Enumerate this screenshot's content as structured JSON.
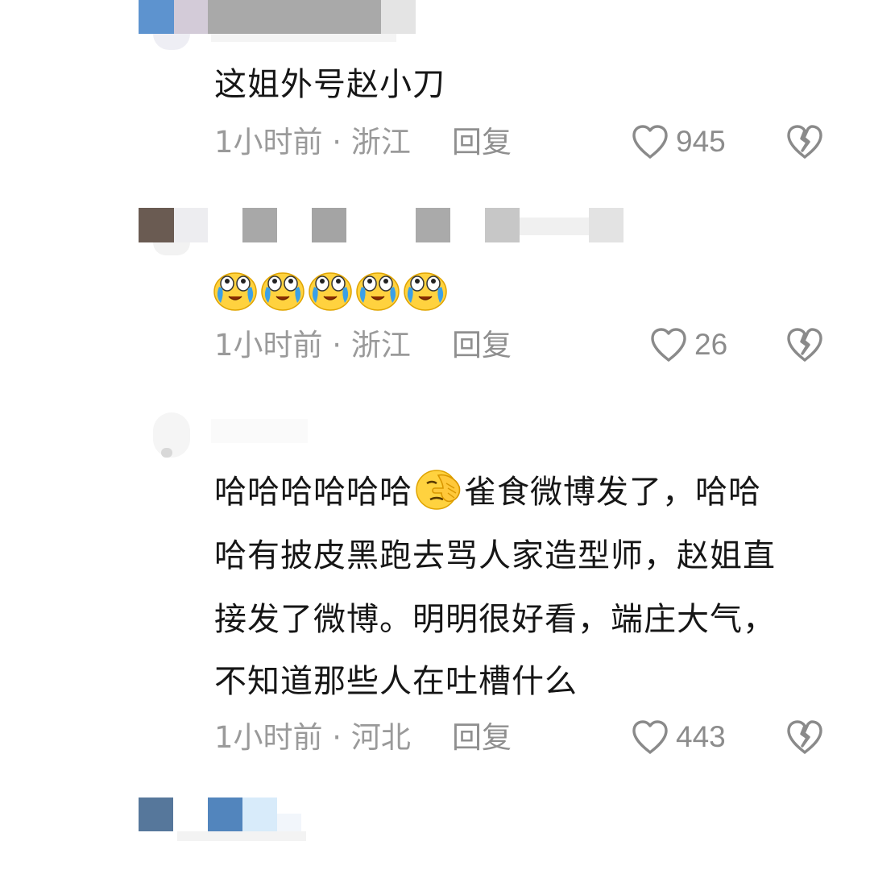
{
  "comments": [
    {
      "text_lines": [
        "这姐外号赵小刀"
      ],
      "time": "1小时前",
      "location": "浙江",
      "reply_label": "回复",
      "like_count": "945"
    },
    {
      "emoji_count": 5,
      "emoji_icon": "crying-laughing-emoji",
      "time": "1小时前",
      "location": "浙江",
      "reply_label": "回复",
      "like_count": "26"
    },
    {
      "text_line_1_before_emoji": "哈哈哈哈哈哈",
      "inline_emoji_icon": "facepalm-emoji",
      "text_line_1_after_emoji": "雀食微博发了，哈哈",
      "text_lines_rest": [
        "哈有披皮黑跑去骂人家造型师，赵姐直",
        "接发了微博。明明很好看，端庄大气，",
        "不知道那些人在吐槽什么"
      ],
      "time": "1小时前",
      "location": "河北",
      "reply_label": "回复",
      "like_count": "443"
    }
  ],
  "meta_separator": " · ",
  "colors": {
    "text": "#161616",
    "meta": "#9a9a9a",
    "icon": "#8a8a8a",
    "emoji_face": "#ffd23f",
    "emoji_tears": "#3aa0e8"
  }
}
